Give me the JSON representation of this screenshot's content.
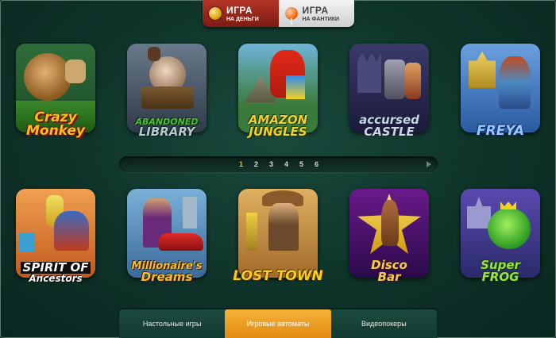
{
  "mode_switch": {
    "money": {
      "title": "ИГРА",
      "sub": "НА ДЕНЬГИ",
      "icon": "coin-icon",
      "active": true
    },
    "candy": {
      "title": "ИГРА",
      "sub": "НА ФАНТИКИ",
      "icon": "lollipop-icon",
      "active": false
    }
  },
  "games_row1": [
    {
      "logo1": "Crazy",
      "logo2": "Monkey",
      "accent": "#f2c21b"
    },
    {
      "logo1": "ABANDONED",
      "logo2": "LIBRARY",
      "accent": "#3fae3a"
    },
    {
      "logo1": "AMAZON",
      "logo2": "JUNGLES",
      "accent": "#f4cf2a"
    },
    {
      "logo1": "accursed",
      "logo2": "CASTLE",
      "accent": "#c8d4e0"
    },
    {
      "logo1": "",
      "logo2": "FREYA",
      "accent": "#8ab6ff"
    }
  ],
  "games_row2": [
    {
      "logo1": "SPIRIT OF",
      "logo2": "Ancestors",
      "accent": "#ffffff"
    },
    {
      "logo1": "Millionaire's",
      "logo2": "Dreams",
      "accent": "#f0c030"
    },
    {
      "logo1": "",
      "logo2": "LOST TOWN",
      "accent": "#f4d020"
    },
    {
      "logo1": "Disco",
      "logo2": "Bar",
      "accent": "#f5d040"
    },
    {
      "logo1": "Super",
      "logo2": "FROG",
      "accent": "#9ee04a"
    }
  ],
  "pager": {
    "pages": [
      "1",
      "2",
      "3",
      "4",
      "5",
      "6"
    ],
    "current": "1"
  },
  "tabs": [
    {
      "label": "Настольные игры",
      "active": false
    },
    {
      "label": "Игровые автоматы",
      "active": true
    },
    {
      "label": "Видеопокеры",
      "active": false
    }
  ],
  "colors": {
    "bg": "#0e3329",
    "active_tab": "#f0a020",
    "active_mode": "#9c2a1c",
    "current_page": "#f4c020"
  }
}
